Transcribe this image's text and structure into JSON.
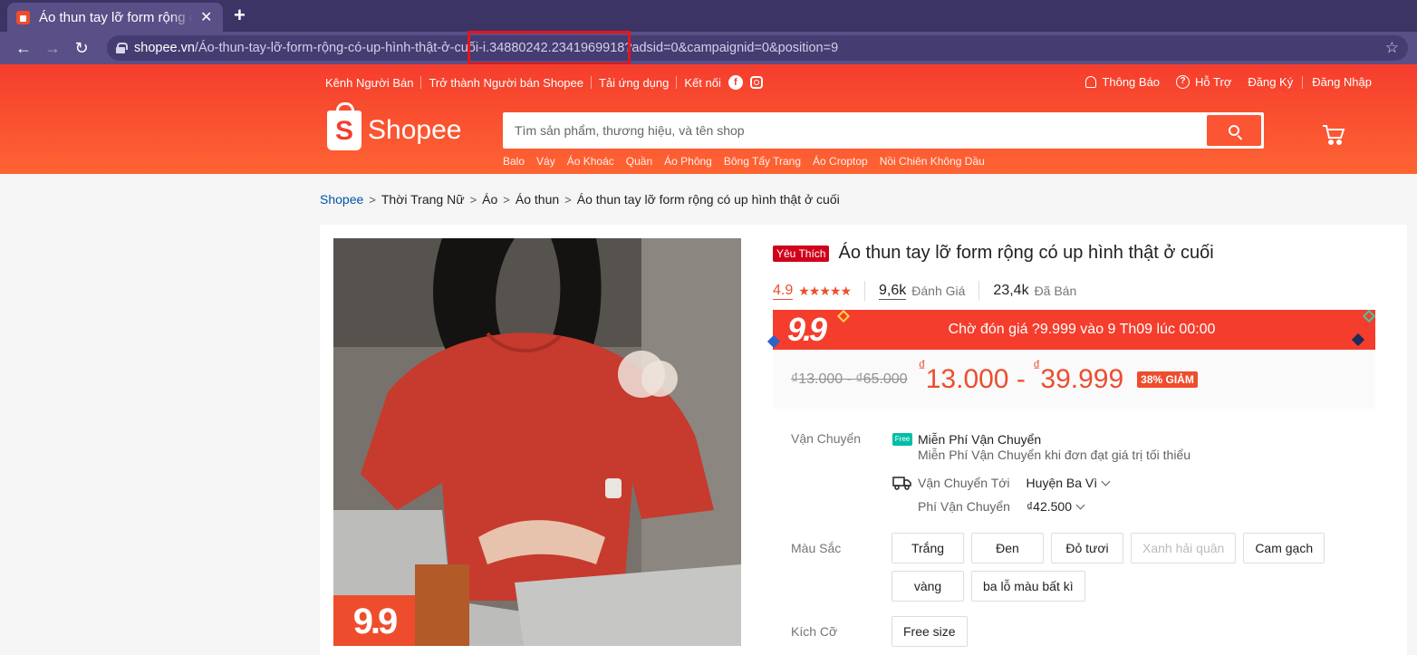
{
  "browser": {
    "tab_title": "Áo thun tay lỡ form rộng có up hình thật ở cuối",
    "tab_close": "✕",
    "new_tab": "+",
    "url_host": "shopee.vn",
    "url_path": "/Áo-thun-tay-lỡ-form-rộng-có-up-hình-thật-ở-cuối-i.34880242.2341969918?adsid=0&campaignid=0&position=9"
  },
  "header": {
    "topnav": [
      "Kênh Người Bán",
      "Trở thành Người bán Shopee",
      "Tải ứng dụng"
    ],
    "connect_label": "Kết nối",
    "notifications": "Thông Báo",
    "support": "Hỗ Trợ",
    "register": "Đăng Ký",
    "login": "Đăng Nhập",
    "logo_text": "Shopee",
    "logo_letter": "S",
    "search_placeholder": "Tìm sản phẩm, thương hiệu, và tên shop",
    "suggestions": [
      "Balo",
      "Váy",
      "Áo Khoác",
      "Quần",
      "Áo Phông",
      "Bông Tẩy Trang",
      "Áo Croptop",
      "Nồi Chiên Không Dầu"
    ]
  },
  "breadcrumb": [
    "Shopee",
    "Thời Trang Nữ",
    "Áo",
    "Áo thun",
    "Áo thun tay lỡ form rộng có up hình thật ở cuối"
  ],
  "product": {
    "image_badge": "9.9",
    "favorite_badge": "Yêu Thích",
    "title": "Áo thun tay lỡ form rộng có up hình thật ở cuối",
    "rating": "4.9",
    "stars": "★★★★★",
    "reviews_count": "9,6k",
    "reviews_label": "Đánh Giá",
    "sold_count": "23,4k",
    "sold_label": "Đã Bán",
    "flash_logo": "9.9",
    "flash_text": "Chờ đón giá ?9.999 vào 9 Th09 lúc 00:00",
    "old_price": "₫13.000 - ₫65.000",
    "currency": "₫",
    "price_low": "13.000",
    "price_sep": " - ",
    "price_high": "39.999",
    "discount": "38% GIẢM",
    "shipping": {
      "label": "Vận Chuyển",
      "free_icon": "Free",
      "free_title": "Miễn Phí Vận Chuyển",
      "free_desc": "Miễn Phí Vận Chuyển khi đơn đạt giá trị tối thiểu",
      "to_label": "Vận Chuyển Tới",
      "to_value": "Huyện Ba Vì",
      "fee_label": "Phí Vận Chuyển",
      "fee_value": "₫42.500"
    },
    "color_label": "Màu Sắc",
    "colors": [
      "Trắng",
      "Đen",
      "Đỏ tươi",
      "Xanh hải quân",
      "Cam gạch",
      "vàng",
      "ba lỗ màu bất kì"
    ],
    "disabled_color": "Xanh hải quân",
    "size_label": "Kích Cỡ",
    "sizes": [
      "Free size"
    ]
  },
  "colors": {
    "brand": "#ee4d2d",
    "header_gradient_top": "#f53d2d",
    "header_gradient_bottom": "#fe6433",
    "browser_frame": "#5a4f86",
    "highlight_box": "#e3161a"
  }
}
